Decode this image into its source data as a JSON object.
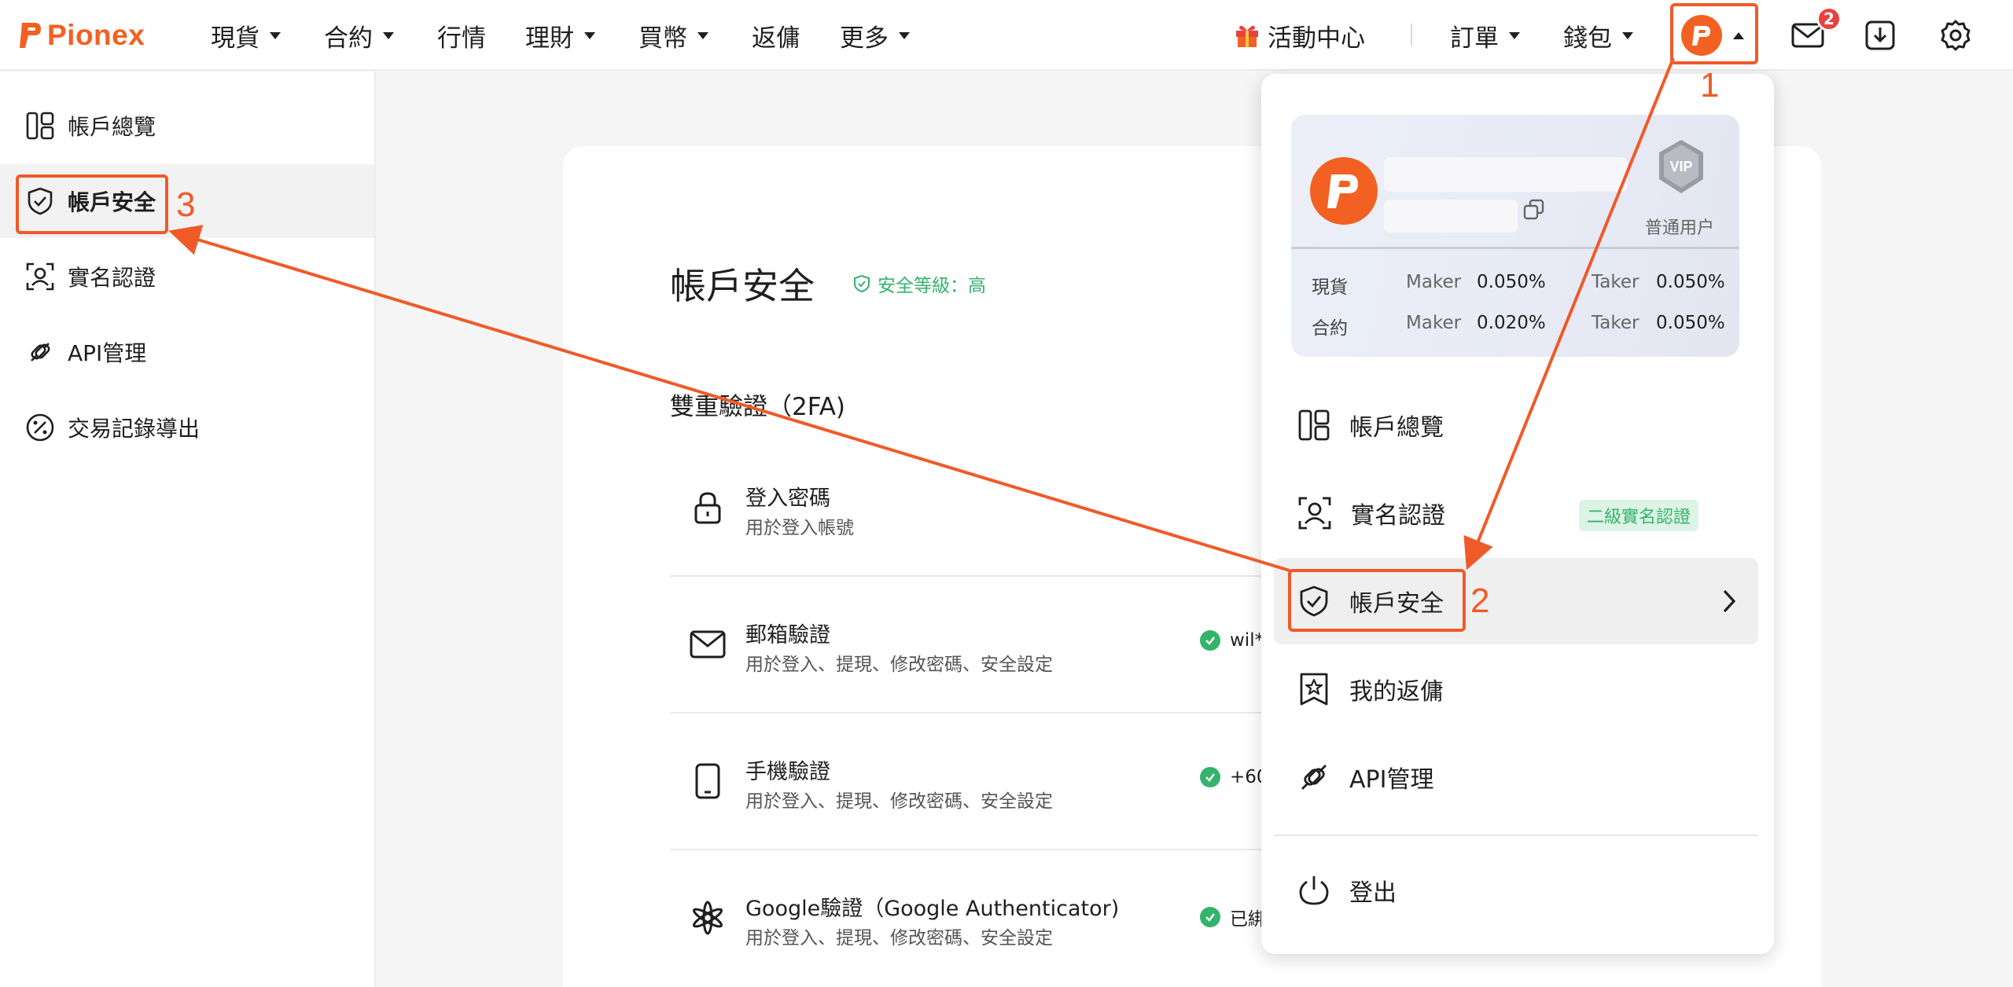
{
  "header": {
    "brand": "Pionex",
    "nav": [
      {
        "label": "現貨",
        "has_caret": true
      },
      {
        "label": "合約",
        "has_caret": true
      },
      {
        "label": "行情",
        "has_caret": false
      },
      {
        "label": "理財",
        "has_caret": true
      },
      {
        "label": "買幣",
        "has_caret": true
      },
      {
        "label": "返傭",
        "has_caret": false
      },
      {
        "label": "更多",
        "has_caret": true
      }
    ],
    "events": "活動中心",
    "orders": "訂單",
    "wallet": "錢包",
    "mail_badge": "2"
  },
  "sidebar": {
    "items": [
      {
        "label": "帳戶總覽",
        "icon": "dashboard-icon"
      },
      {
        "label": "帳戶安全",
        "icon": "shield-check-icon",
        "active": true
      },
      {
        "label": "實名認證",
        "icon": "user-id-icon"
      },
      {
        "label": "API管理",
        "icon": "link-plug-icon"
      },
      {
        "label": "交易記錄導出",
        "icon": "percent-circle-icon"
      }
    ]
  },
  "main": {
    "title": "帳戶安全",
    "security_level": "安全等級：高",
    "section_title": "雙重驗證（2FA)",
    "rows": [
      {
        "title": "登入密碼",
        "subtitle": "用於登入帳號",
        "status": "",
        "icon": "lock-icon"
      },
      {
        "title": "郵箱驗證",
        "subtitle": "用於登入、提現、修改密碼、安全設定",
        "status": "wil*",
        "icon": "mail-icon"
      },
      {
        "title": "手機驗證",
        "subtitle": "用於登入、提現、修改密碼、安全設定",
        "status": "+60",
        "icon": "phone-icon"
      },
      {
        "title": "Google驗證（Google Authenticator)",
        "subtitle": "用於登入、提現、修改密碼、安全設定",
        "status": "已綁",
        "icon": "authenticator-icon"
      }
    ]
  },
  "dropdown": {
    "vip_label": "普通用户",
    "vip_badge": "VIP",
    "fees": [
      {
        "name": "現貨",
        "maker_label": "Maker",
        "maker": "0.050%",
        "taker_label": "Taker",
        "taker": "0.050%"
      },
      {
        "name": "合約",
        "maker_label": "Maker",
        "maker": "0.020%",
        "taker_label": "Taker",
        "taker": "0.050%"
      }
    ],
    "items": [
      {
        "label": "帳戶總覽",
        "icon": "dashboard-icon"
      },
      {
        "label": "實名認證",
        "icon": "user-id-icon",
        "chip": "二級實名認證"
      },
      {
        "label": "帳戶安全",
        "icon": "shield-check-icon",
        "active": true
      },
      {
        "label": "我的返傭",
        "icon": "star-bookmark-icon"
      },
      {
        "label": "API管理",
        "icon": "link-plug-icon"
      },
      {
        "label": "登出",
        "icon": "power-icon"
      }
    ]
  },
  "annotations": [
    "1",
    "2",
    "3"
  ],
  "colors": {
    "brand": "#f26122",
    "annotation": "#f05a28",
    "success": "#33b36b",
    "badge": "#e8423f"
  }
}
